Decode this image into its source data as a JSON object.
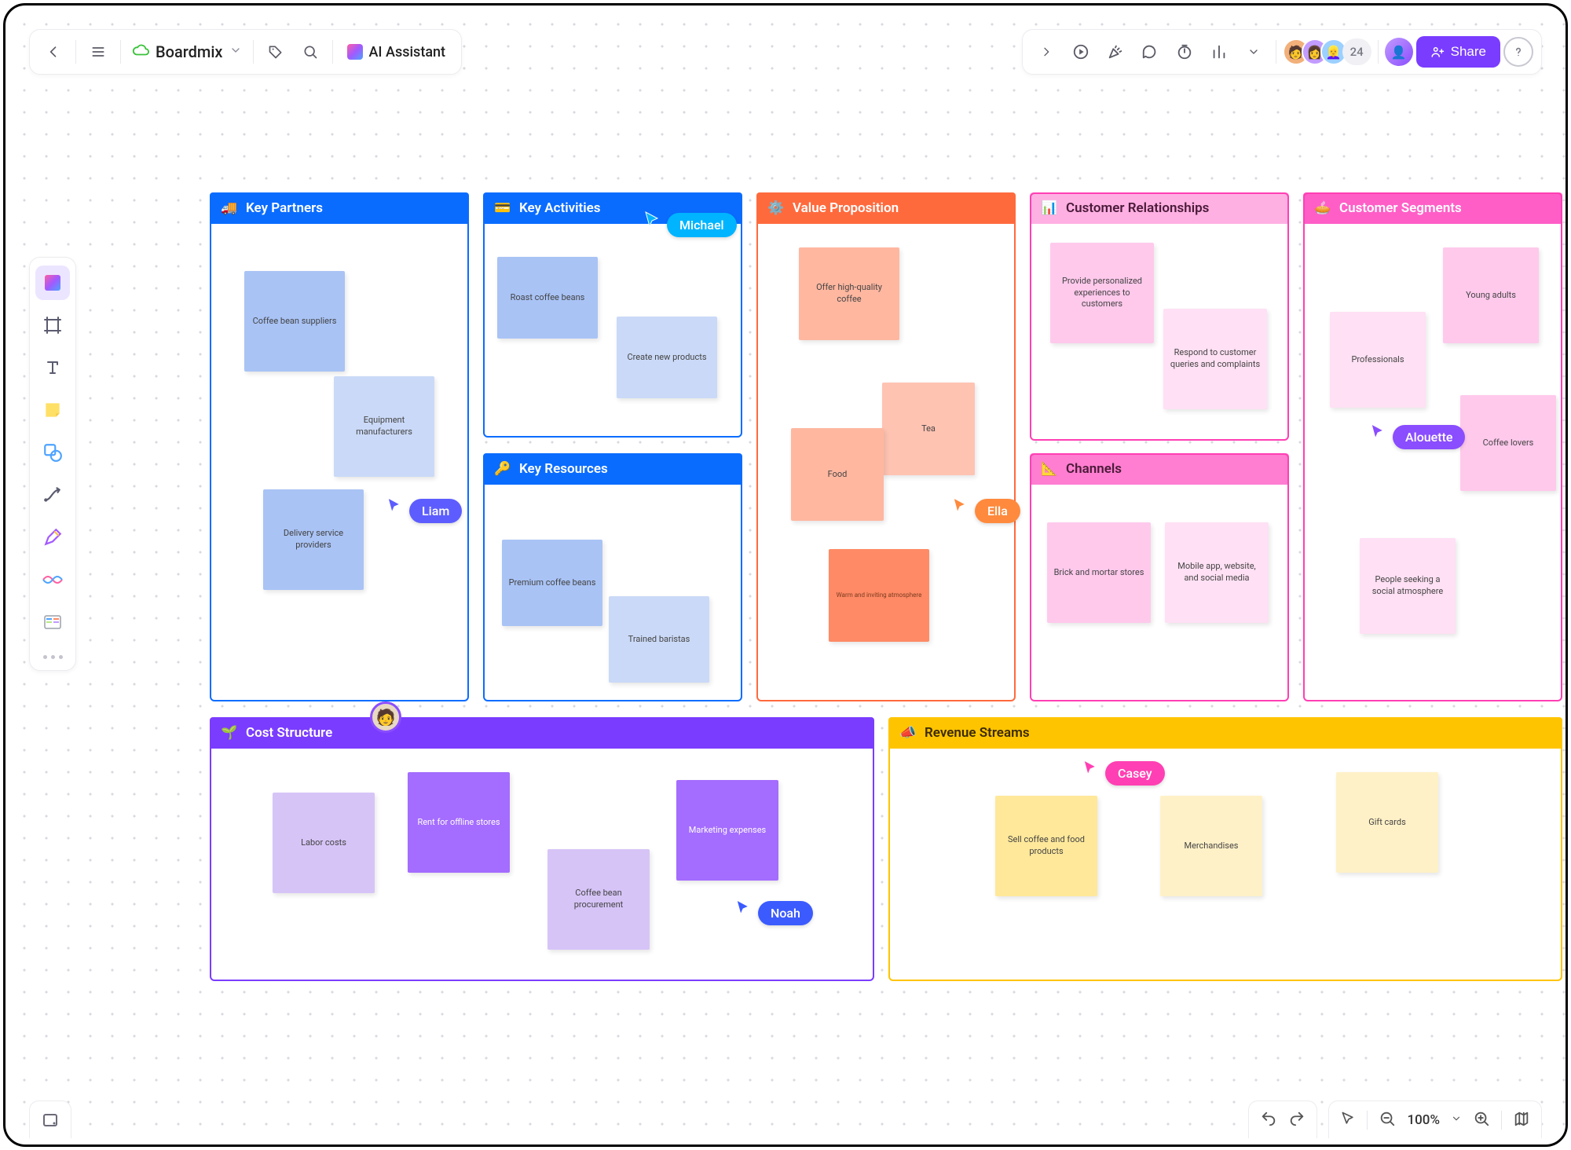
{
  "app": {
    "name": "Boardmix",
    "ai_label": "AI Assistant",
    "share_label": "Share",
    "extra_collaborators": "24",
    "zoom": "100%"
  },
  "cursors": {
    "michael": "Michael",
    "liam": "Liam",
    "ella": "Ella",
    "alouette": "Alouette",
    "noah": "Noah",
    "casey": "Casey"
  },
  "panels": {
    "key_partners": {
      "title": "Key Partners",
      "notes": [
        "Coffee bean suppliers",
        "Equipment manufacturers",
        "Delivery service providers"
      ]
    },
    "key_activities": {
      "title": "Key Activities",
      "notes": [
        "Roast coffee beans",
        "Create new products"
      ]
    },
    "key_resources": {
      "title": "Key Resources",
      "notes": [
        "Premium coffee beans",
        "Trained baristas"
      ]
    },
    "value_proposition": {
      "title": "Value Proposition",
      "notes": [
        "Offer high-quality coffee",
        "Tea",
        "Food",
        "Warm and inviting atmosphere"
      ]
    },
    "customer_relationships": {
      "title": "Customer Relationships",
      "notes": [
        "Provide personalized experiences to customers",
        "Respond to customer queries and complaints"
      ]
    },
    "channels": {
      "title": "Channels",
      "notes": [
        "Brick and mortar stores",
        "Mobile app, website, and social media"
      ]
    },
    "customer_segments": {
      "title": "Customer Segments",
      "notes": [
        "Young adults",
        "Professionals",
        "Coffee lovers",
        "People seeking a social atmosphere"
      ]
    },
    "cost_structure": {
      "title": "Cost Structure",
      "notes": [
        "Labor costs",
        "Rent for offline stores",
        "Coffee bean procurement",
        "Marketing expenses"
      ]
    },
    "revenue_streams": {
      "title": "Revenue Streams",
      "notes": [
        "Sell coffee and food products",
        "Merchandises",
        "Gift cards"
      ]
    }
  }
}
